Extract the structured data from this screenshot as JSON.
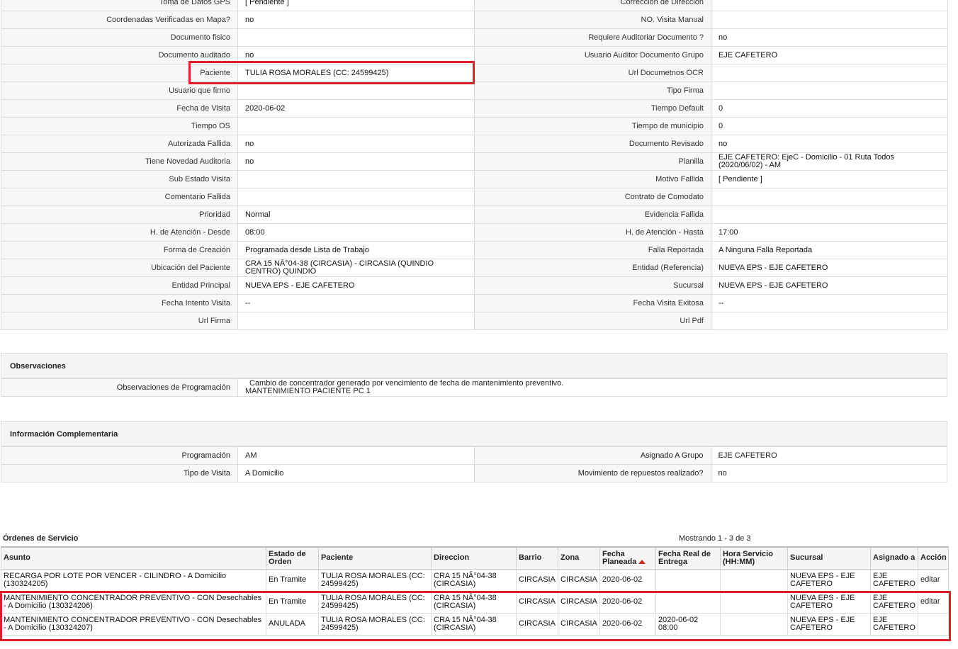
{
  "detail_rows": [
    [
      {
        "label": "Toma de Datos GPS",
        "value": "[ Pendiente ]"
      },
      {
        "label": "Correccion de Direccion",
        "value": ""
      }
    ],
    [
      {
        "label": "Coordenadas Verificadas en Mapa?",
        "value": "no"
      },
      {
        "label": "NO. Visita Manual",
        "value": ""
      }
    ],
    [
      {
        "label": "Documento fisico",
        "value": ""
      },
      {
        "label": "Requiere Auditoriar Documento ?",
        "value": "no"
      }
    ],
    [
      {
        "label": "Documento auditado",
        "value": "no"
      },
      {
        "label": "Usuario Auditor Documento Grupo",
        "value": "EJE CAFETERO"
      }
    ],
    [
      {
        "label": "Paciente",
        "value": "TULIA ROSA MORALES (CC: 24599425)"
      },
      {
        "label": "Url Documetnos OCR",
        "value": ""
      }
    ],
    [
      {
        "label": "Usuario que firmo",
        "value": ""
      },
      {
        "label": "Tipo Firma",
        "value": ""
      }
    ],
    [
      {
        "label": "Fecha de Visita",
        "value": "2020-06-02"
      },
      {
        "label": "Tiempo Default",
        "value": "0"
      }
    ],
    [
      {
        "label": "Tiempo OS",
        "value": ""
      },
      {
        "label": "Tiempo de municipio",
        "value": "0"
      }
    ],
    [
      {
        "label": "Autorizada Fallida",
        "value": "no"
      },
      {
        "label": "Documento Revisado",
        "value": "no"
      }
    ],
    [
      {
        "label": "Tiene Novedad Auditoria",
        "value": "no"
      },
      {
        "label": "Planilla",
        "value": "EJE CAFETERO: EjeC - Domicilio - 01 Ruta Todos (2020/06/02) - AM"
      }
    ],
    [
      {
        "label": "Sub Estado Visita",
        "value": ""
      },
      {
        "label": "Motivo Fallida",
        "value": "[ Pendiente ]"
      }
    ],
    [
      {
        "label": "Comentario Fallida",
        "value": ""
      },
      {
        "label": "Contrato de Comodato",
        "value": ""
      }
    ],
    [
      {
        "label": "Prioridad",
        "value": "Normal"
      },
      {
        "label": "Evidencia Fallida",
        "value": ""
      }
    ],
    [
      {
        "label": "H. de Atención - Desde",
        "value": "08:00"
      },
      {
        "label": "H. de Atención - Hasta",
        "value": "17:00"
      }
    ],
    [
      {
        "label": "Forma de Creación",
        "value": "Programada desde Lista de Trabajo"
      },
      {
        "label": "Falla Reportada",
        "value": "A Ninguna Falla Reportada"
      }
    ],
    [
      {
        "label": "Ubicación del Paciente",
        "value": "CRA 15 NÂ°04-38 (CIRCASIA) - CIRCASIA (QUINDIO CENTRO) QUINDIO"
      },
      {
        "label": "Entidad (Referencia)",
        "value": "NUEVA EPS - EJE CAFETERO"
      }
    ],
    [
      {
        "label": "Entidad Principal",
        "value": "NUEVA EPS - EJE CAFETERO"
      },
      {
        "label": "Sucursal",
        "value": "NUEVA EPS - EJE CAFETERO"
      }
    ],
    [
      {
        "label": "Fecha Intento Visita",
        "value": "--"
      },
      {
        "label": "Fecha Visita Exitosa",
        "value": "--"
      }
    ],
    [
      {
        "label": "Url Firma",
        "value": ""
      },
      {
        "label": "Url Pdf",
        "value": ""
      }
    ]
  ],
  "observaciones": {
    "title": "Observaciones",
    "label": "Observaciones de Programación",
    "line1": "Cambio de concentrador generado por vencimiento de fecha de mantenimiento preventivo.",
    "line2": "MANTENIMIENTO PACIENTE PC 1"
  },
  "info_complementaria": {
    "title": "Información Complementaria",
    "rows": [
      [
        {
          "label": "Programación",
          "value": "AM"
        },
        {
          "label": "Asignado A Grupo",
          "value": "EJE CAFETERO"
        }
      ],
      [
        {
          "label": "Tipo de Visita",
          "value": "A Domicilio"
        },
        {
          "label": "Movimiento de repuestos realizado?",
          "value": "no"
        }
      ]
    ]
  },
  "ordenes": {
    "title": "Órdenes de Servicio",
    "count": "Mostrando 1 - 3 de 3",
    "columns": [
      "Asunto",
      "Estado de Orden",
      "Paciente",
      "Direccion",
      "Barrio",
      "Zona",
      "Fecha Planeada",
      "Fecha Real de Entrega",
      "Hora Servicio (HH:MM)",
      "Sucursal",
      "Asignado a",
      "Acción"
    ],
    "sort_icon": "sort-asc-icon",
    "rows": [
      {
        "asunto": "RECARGA POR LOTE POR VENCER - CILINDRO - A Domicilio (130324205)",
        "estado": "En Tramite",
        "paciente": "TULIA ROSA MORALES (CC: 24599425)",
        "direccion": "CRA 15 NÂ°04-38 (CIRCASIA)",
        "barrio": "CIRCASIA",
        "zona": "CIRCASIA",
        "fecha_planeada": "2020-06-02",
        "fecha_real": "",
        "hora": "",
        "sucursal": "NUEVA EPS - EJE CAFETERO",
        "asignado": "EJE CAFETERO",
        "accion": "editar"
      },
      {
        "asunto": "MANTENIMIENTO CONCENTRADOR PREVENTIVO - CON Desechables - A Domicilio (130324206)",
        "estado": "En Tramite",
        "paciente": "TULIA ROSA MORALES (CC: 24599425)",
        "direccion": "CRA 15 NÂ°04-38 (CIRCASIA)",
        "barrio": "CIRCASIA",
        "zona": "CIRCASIA",
        "fecha_planeada": "2020-06-02",
        "fecha_real": "",
        "hora": "",
        "sucursal": "NUEVA EPS - EJE CAFETERO",
        "asignado": "EJE CAFETERO",
        "accion": "editar"
      },
      {
        "asunto": "MANTENIMIENTO CONCENTRADOR PREVENTIVO - CON Desechables - A Domicilio (130324207)",
        "estado": "ANULADA",
        "paciente": "TULIA ROSA MORALES (CC: 24599425)",
        "direccion": "CRA 15 NÂ°04-38 (CIRCASIA)",
        "barrio": "CIRCASIA",
        "zona": "CIRCASIA",
        "fecha_planeada": "2020-06-02",
        "fecha_real": "2020-06-02 08:00",
        "hora": "",
        "sucursal": "NUEVA EPS - EJE CAFETERO",
        "asignado": "EJE CAFETERO",
        "accion": ""
      }
    ]
  },
  "highlight_color": "#e01e2b"
}
